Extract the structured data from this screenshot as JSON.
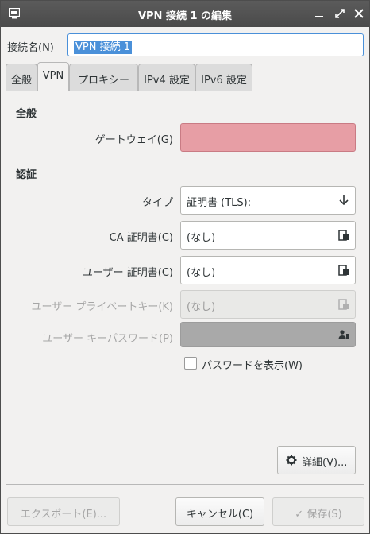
{
  "window": {
    "title": "VPN 接続 1 の編集"
  },
  "connection_name": {
    "label": "接続名(N)",
    "value": "VPN 接続 1"
  },
  "tabs": [
    {
      "label": "全般"
    },
    {
      "label": "VPN",
      "active": true
    },
    {
      "label": "プロキシー"
    },
    {
      "label": "IPv4 設定"
    },
    {
      "label": "IPv6 設定"
    }
  ],
  "vpn": {
    "general_heading": "全般",
    "gateway": {
      "label": "ゲートウェイ(G)",
      "value": ""
    },
    "auth_heading": "認証",
    "type": {
      "label": "タイプ",
      "value": "証明書 (TLS):"
    },
    "ca_cert": {
      "label": "CA 証明書(C)",
      "value": "(なし)"
    },
    "user_cert": {
      "label": "ユーザー 証明書(C)",
      "value": "(なし)"
    },
    "user_private_key": {
      "label": "ユーザー プライベートキー(K)",
      "value": "(なし)"
    },
    "user_key_password": {
      "label": "ユーザー キーパスワード(P)",
      "value": ""
    },
    "show_password": {
      "label": "パスワードを表示(W)",
      "checked": false
    },
    "advanced_button": "詳細(V)..."
  },
  "footer": {
    "export_button": "エクスポート(E)...",
    "cancel_button": "キャンセル(C)",
    "save_button": "保存(S)"
  },
  "colors": {
    "titlebar": "#4a4a4a",
    "accent": "#4a90d9",
    "error_field": "#e79ea5",
    "window_bg": "#f2f1f0"
  }
}
